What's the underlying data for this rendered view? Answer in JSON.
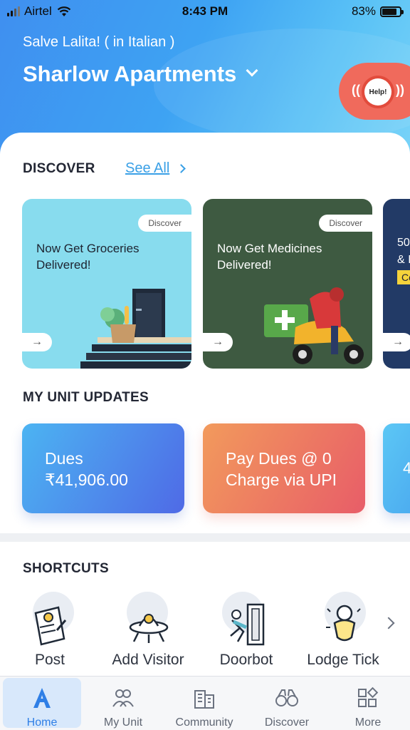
{
  "status_bar": {
    "carrier": "Airtel",
    "time": "8:43 PM",
    "battery": "83%",
    "battery_level": 0.83
  },
  "header": {
    "greeting": "Salve Lalita! ( in Italian )",
    "apartment": "Sharlow Apartments",
    "help_label": "Help!"
  },
  "discover": {
    "title": "DISCOVER",
    "see_all": "See All",
    "cards": [
      {
        "badge": "Discover",
        "line1": "Now Get Groceries",
        "line2": "Delivered!"
      },
      {
        "badge": "Discover",
        "line1": "Now Get Medicines",
        "line2": "Delivered!"
      },
      {
        "line1": "50",
        "line2": "& I",
        "tag": "Co"
      }
    ]
  },
  "unit_updates": {
    "title": "MY UNIT UPDATES",
    "cards": [
      {
        "line1": "Dues",
        "line2": "₹41,906.00"
      },
      {
        "line1": "Pay Dues @ 0",
        "line2": "Charge via UPI"
      },
      {
        "line1": "4"
      }
    ]
  },
  "shortcuts": {
    "title": "SHORTCUTS",
    "items": [
      {
        "label": "Post",
        "icon": "post-icon"
      },
      {
        "label": "Add Visitor",
        "icon": "add-visitor-icon"
      },
      {
        "label": "Doorbot",
        "icon": "doorbot-icon"
      },
      {
        "label": "Lodge Tick",
        "icon": "lodge-ticket-icon"
      }
    ]
  },
  "tabbar": {
    "active": "Home",
    "tabs": [
      {
        "label": "Home",
        "icon": "home-icon"
      },
      {
        "label": "My Unit",
        "icon": "my-unit-icon"
      },
      {
        "label": "Community",
        "icon": "community-icon"
      },
      {
        "label": "Discover",
        "icon": "discover-icon"
      },
      {
        "label": "More",
        "icon": "more-icon"
      }
    ]
  },
  "colors": {
    "accent": "#2f7fe6",
    "header_gradient_start": "#3f8ff0",
    "help_red": "#f06a5c",
    "grocery_card": "#88dcee",
    "medicine_card": "#3e5a41"
  }
}
